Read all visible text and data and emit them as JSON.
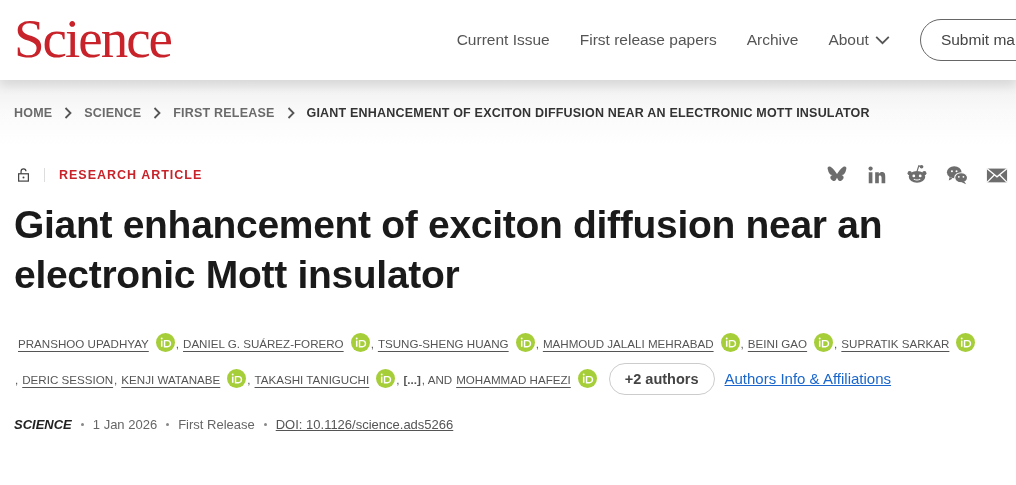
{
  "header": {
    "logo": "Science",
    "nav": [
      {
        "label": "Current Issue",
        "kind": "link"
      },
      {
        "label": "First release papers",
        "kind": "link"
      },
      {
        "label": "Archive",
        "kind": "link"
      },
      {
        "label": "About",
        "kind": "menu"
      }
    ],
    "submit": "Submit ma"
  },
  "breadcrumb": [
    {
      "label": "HOME",
      "current": false
    },
    {
      "label": "SCIENCE",
      "current": false
    },
    {
      "label": "FIRST RELEASE",
      "current": false
    },
    {
      "label": "GIANT ENHANCEMENT OF EXCITON DIFFUSION NEAR AN ELECTRONIC MOTT INSULATOR",
      "current": true
    }
  ],
  "article": {
    "locked": false,
    "type": "RESEARCH ARTICLE",
    "title": "Giant enhancement of exciton diffusion near an electronic Mott insulator",
    "authors": [
      {
        "kind": "author",
        "name": "PRANSHOO UPADHYAY",
        "orcid": true
      },
      {
        "kind": "text",
        "text": ","
      },
      {
        "kind": "author",
        "name": "DANIEL G. SUÁREZ-FORERO",
        "orcid": true
      },
      {
        "kind": "text",
        "text": ","
      },
      {
        "kind": "author",
        "name": "TSUNG-SHENG HUANG",
        "orcid": true
      },
      {
        "kind": "text",
        "text": ","
      },
      {
        "kind": "author",
        "name": "MAHMOUD JALALI MEHRABAD",
        "orcid": true
      },
      {
        "kind": "text",
        "text": ","
      },
      {
        "kind": "author",
        "name": "BEINI GAO",
        "orcid": true
      },
      {
        "kind": "text",
        "text": ","
      },
      {
        "kind": "author",
        "name": "SUPRATIK SARKAR",
        "orcid": true
      },
      {
        "kind": "text",
        "text": ","
      },
      {
        "kind": "author",
        "name": "DERIC SESSION",
        "orcid": false
      },
      {
        "kind": "text",
        "text": ","
      },
      {
        "kind": "author",
        "name": "KENJI WATANABE",
        "orcid": true
      },
      {
        "kind": "text",
        "text": ","
      },
      {
        "kind": "author",
        "name": "TAKASHI TANIGUCHI",
        "orcid": true
      },
      {
        "kind": "text",
        "text": ","
      },
      {
        "kind": "more",
        "text": "[...]"
      },
      {
        "kind": "text",
        "text": ", AND"
      },
      {
        "kind": "author",
        "name": "MOHAMMAD HAFEZI",
        "orcid": true
      }
    ],
    "more_authors": "+2 authors",
    "affiliations": "Authors Info & Affiliations",
    "journal": "SCIENCE",
    "date": "1 Jan 2026",
    "status": "First Release",
    "doi": "DOI: 10.1126/science.ads5266"
  }
}
